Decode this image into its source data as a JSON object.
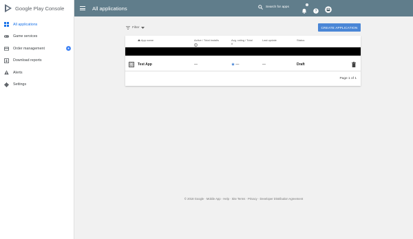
{
  "brand": {
    "name": "Google Play Console"
  },
  "header": {
    "title": "All applications",
    "search_placeholder": "Search for apps",
    "notifications_count": "1"
  },
  "sidebar": {
    "items": [
      {
        "label": "All applications",
        "icon": "apps-icon",
        "active": true
      },
      {
        "label": "Game services",
        "icon": "gamepad-icon"
      },
      {
        "label": "Order management",
        "icon": "card-icon",
        "badge": "new"
      },
      {
        "label": "Download reports",
        "icon": "download-icon"
      },
      {
        "label": "Alerts",
        "icon": "alert-icon"
      },
      {
        "label": "Settings",
        "icon": "gear-icon"
      }
    ]
  },
  "toolbar": {
    "filter_label": "Filter",
    "create_label": "CREATE APPLICATION"
  },
  "table": {
    "columns": {
      "app_name": "App name",
      "installs": "Active / Total installs",
      "rating": "Avg. rating / Total #",
      "last_update": "Last update",
      "status": "Status"
    },
    "rows": [
      {
        "app_name": "Test App",
        "installs": "—",
        "rating": "—",
        "last_update": "—",
        "status": "Draft"
      }
    ],
    "pagination": "Page 1 of 1"
  },
  "footer": {
    "text": "© 2018 Google · Mobile App · Help · Site Terms · Privacy · Developer Distribution Agreement"
  },
  "colors": {
    "header": "#607d8b",
    "accent": "#4a86d6",
    "active_nav": "#1a73e8"
  }
}
